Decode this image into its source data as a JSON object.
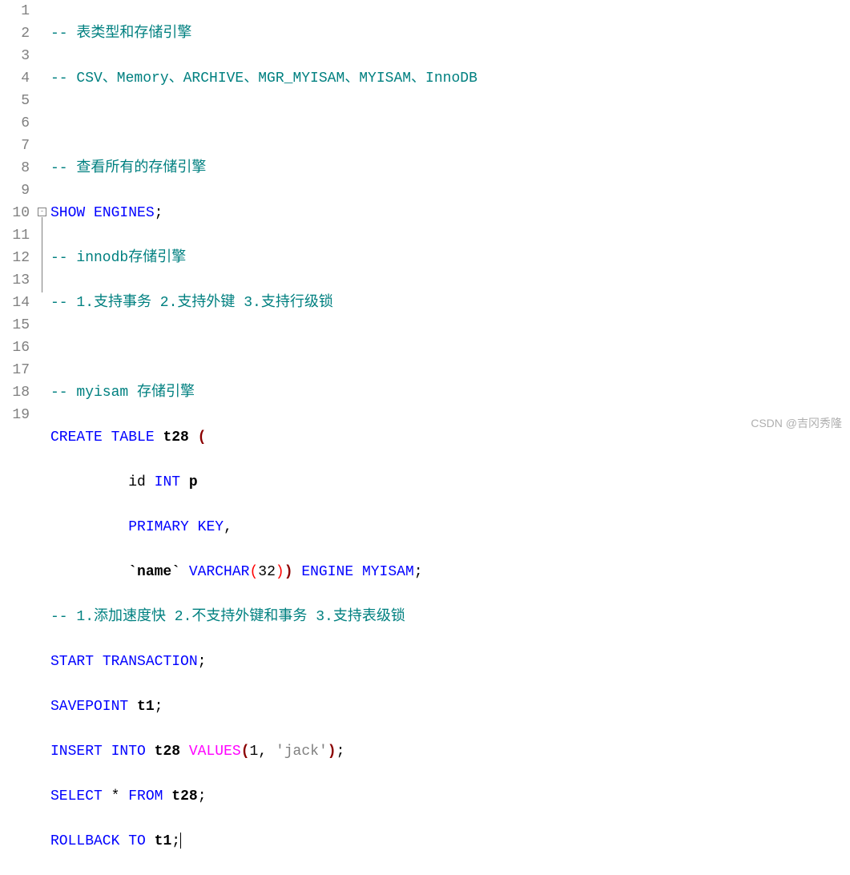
{
  "gutter": [
    "1",
    "2",
    "3",
    "4",
    "5",
    "6",
    "7",
    "8",
    "9",
    "10",
    "11",
    "12",
    "13",
    "14",
    "15",
    "16",
    "17",
    "18",
    "19"
  ],
  "code": {
    "l1_comment": "-- 表类型和存储引擎",
    "l2_comment": "-- CSV、Memory、ARCHIVE、MGR_MYISAM、MYISAM、InnoDB",
    "l4_comment": "-- 查看所有的存储引擎",
    "l5_kw1": "SHOW",
    "l5_kw2": "ENGINES",
    "l5_sc": ";",
    "l6_comment": "-- innodb存储引擎",
    "l7_comment": "-- 1.支持事务 2.支持外键 3.支持行级锁",
    "l9_comment": "-- myisam 存储引擎",
    "l10_kw1": "CREATE",
    "l10_kw2": "TABLE",
    "l10_ident": "t28",
    "l10_paren": "(",
    "l11_ident": "id",
    "l11_kw": "INT",
    "l11_p": "p",
    "l12_kw1": "PRIMARY",
    "l12_kw2": "KEY",
    "l12_comma": ",",
    "l13_name": "`name`",
    "l13_kw": "VARCHAR",
    "l13_po": "(",
    "l13_num": "32",
    "l13_pc": ")",
    "l13_pc2": ")",
    "l13_kw2": "ENGINE",
    "l13_kw3": "MYISAM",
    "l13_sc": ";",
    "l14_comment": "-- 1.添加速度快 2.不支持外键和事务 3.支持表级锁",
    "l15_kw1": "START",
    "l15_kw2": "TRANSACTION",
    "l15_sc": ";",
    "l16_kw": "SAVEPOINT",
    "l16_ident": "t1",
    "l16_sc": ";",
    "l17_kw1": "INSERT",
    "l17_kw2": "INTO",
    "l17_ident": "t28",
    "l17_fn": "VALUES",
    "l17_po": "(",
    "l17_num": "1",
    "l17_comma": ",",
    "l17_str": "'jack'",
    "l17_pc": ")",
    "l17_sc": ";",
    "l18_kw1": "SELECT",
    "l18_star": "*",
    "l18_kw2": "FROM",
    "l18_ident": "t28",
    "l18_sc": ";",
    "l19_kw1": "ROLLBACK",
    "l19_kw2": "TO",
    "l19_ident": "t1",
    "l19_sc": ";"
  },
  "watermark": "CSDN @吉冈秀隆"
}
